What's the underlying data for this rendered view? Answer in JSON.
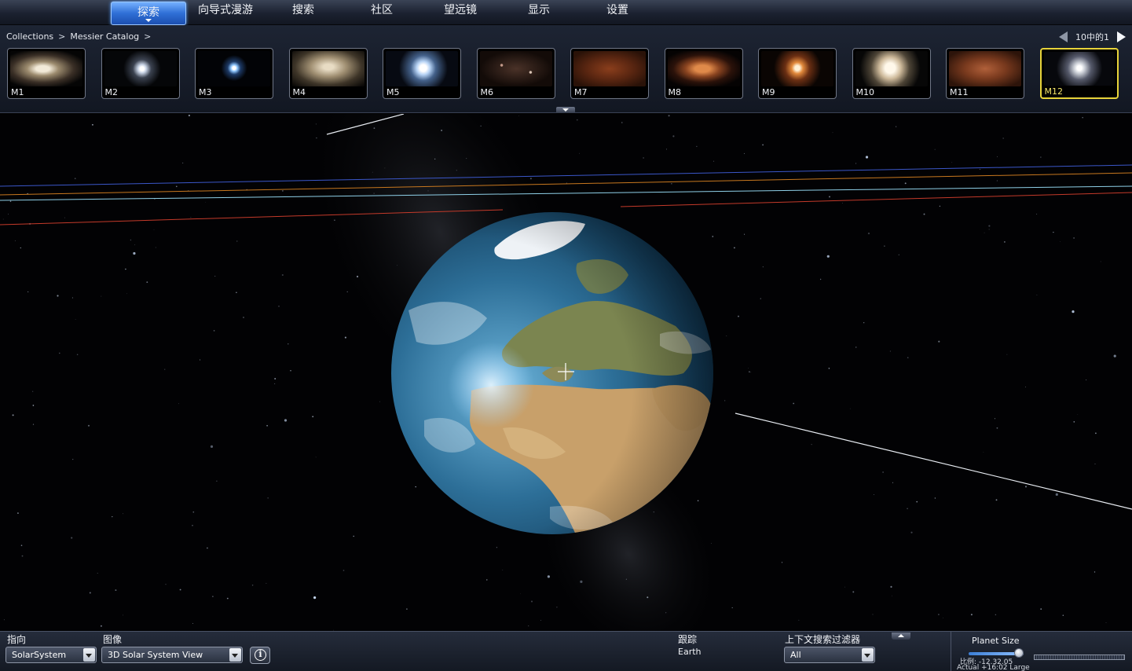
{
  "menu": {
    "items": [
      {
        "label": "探索",
        "active": true
      },
      {
        "label": "向导式漫游",
        "active": false
      },
      {
        "label": "搜索",
        "active": false
      },
      {
        "label": "社区",
        "active": false
      },
      {
        "label": "望远镜",
        "active": false
      },
      {
        "label": "显示",
        "active": false
      },
      {
        "label": "设置",
        "active": false
      }
    ]
  },
  "breadcrumb": {
    "root": "Collections",
    "current": "Messier Catalog",
    "separator": ">"
  },
  "pager": {
    "text": "10中的1"
  },
  "thumbnails": [
    {
      "label": "M1",
      "style": "nebula-white"
    },
    {
      "label": "M2",
      "style": "globular-small"
    },
    {
      "label": "M3",
      "style": "star-blue"
    },
    {
      "label": "M4",
      "style": "globular-wide"
    },
    {
      "label": "M5",
      "style": "globular-blue"
    },
    {
      "label": "M6",
      "style": "open-cluster"
    },
    {
      "label": "M7",
      "style": "open-cluster-red"
    },
    {
      "label": "M8",
      "style": "nebula-orange"
    },
    {
      "label": "M9",
      "style": "globular-orange"
    },
    {
      "label": "M10",
      "style": "globular-bright"
    },
    {
      "label": "M11",
      "style": "open-cluster-dense"
    },
    {
      "label": "M12",
      "style": "globular-grey",
      "selected": true
    }
  ],
  "view": {
    "subject": "Earth",
    "crosshair": "crosshair-icon",
    "colors": {
      "orbit_blue": "#3b57c9",
      "orbit_orange": "#c8781f",
      "orbit_cyan": "#8fd0e8",
      "orbit_red": "#c43a2a",
      "orbit_white": "#e8ecf2"
    }
  },
  "bottom": {
    "look_at_label": "指向",
    "look_at_value": "SolarSystem",
    "imagery_label": "图像",
    "imagery_value": "3D Solar System View",
    "track_label": "跟踪",
    "track_value": "Earth",
    "context_filter_label": "上下文搜索过滤器",
    "context_filter_value": "All",
    "planet_size_label": "Planet Size",
    "planet_size_level": 0.92,
    "scale_line1": "比例: -12.32.05",
    "scale_line2": "Actual  +16:02 Large"
  }
}
